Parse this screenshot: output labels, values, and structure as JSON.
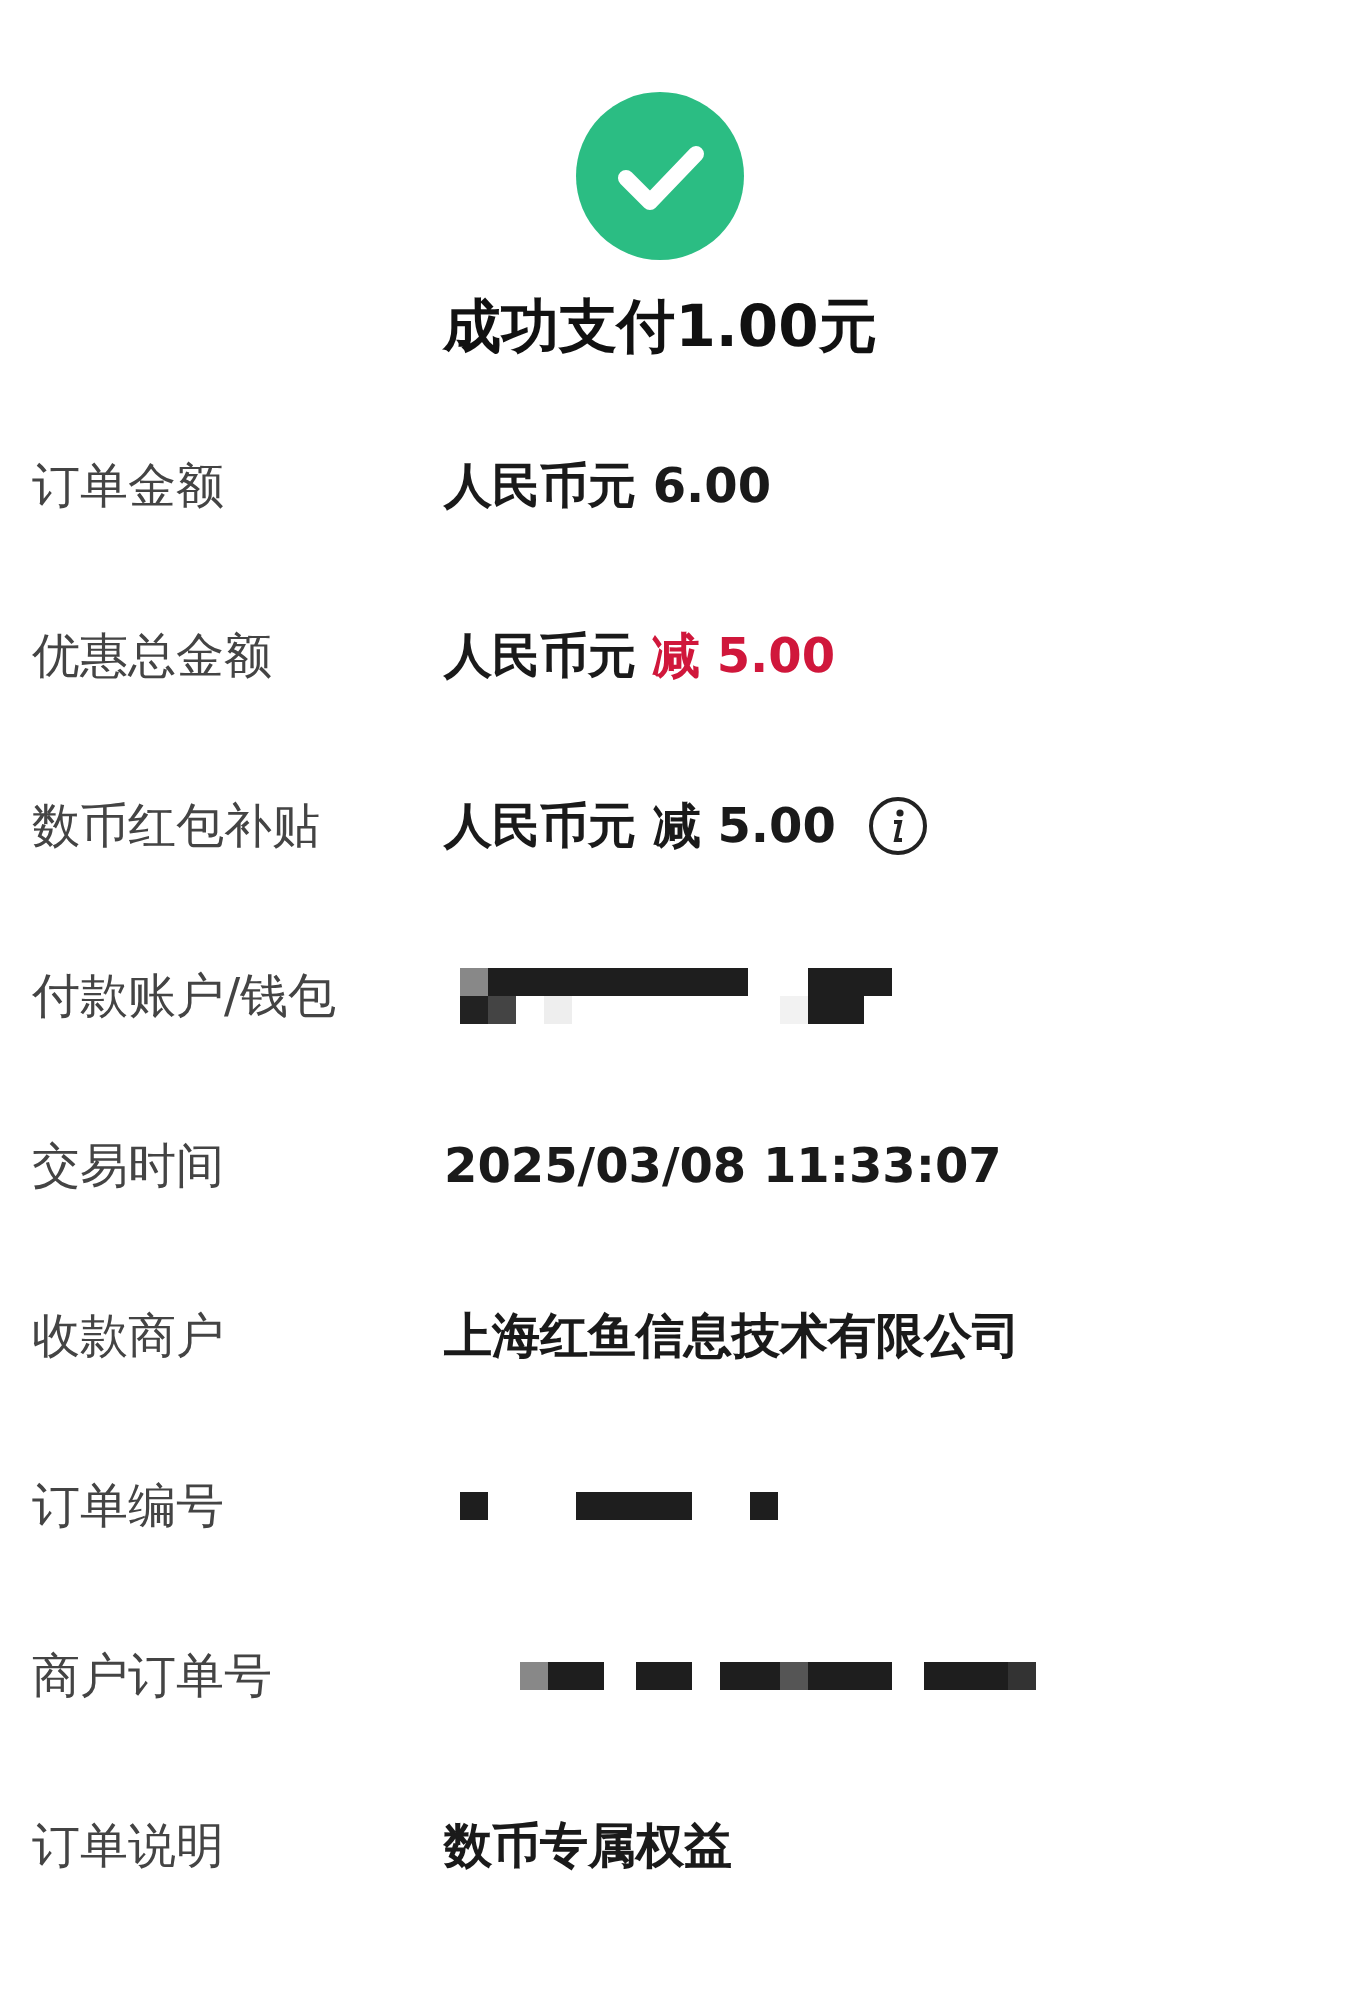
{
  "status": {
    "kind": "success",
    "title": "成功支付1.00元"
  },
  "rows": [
    {
      "label": "订单金额",
      "kind": "text",
      "value_parts": [
        {
          "text": "人民币元 6.00",
          "highlighted": false
        }
      ]
    },
    {
      "label": "优惠总金额",
      "kind": "text",
      "value_parts": [
        {
          "text": "人民币元",
          "highlighted": false
        },
        {
          "text": "减 5.00",
          "highlighted": true
        }
      ]
    },
    {
      "label": "数币红包补贴",
      "kind": "text",
      "info_button": true,
      "value_parts": [
        {
          "text": "人民币元 减 5.00",
          "highlighted": false
        }
      ]
    },
    {
      "label": "付款账户/钱包",
      "kind": "redacted"
    },
    {
      "label": "交易时间",
      "kind": "text",
      "value_parts": [
        {
          "text": "2025/03/08 11:33:07",
          "highlighted": false
        }
      ]
    },
    {
      "label": "收款商户",
      "kind": "text",
      "value_parts": [
        {
          "text": "上海红鱼信息技术有限公司",
          "highlighted": false
        }
      ]
    },
    {
      "label": "订单编号",
      "kind": "redacted"
    },
    {
      "label": "商户订单号",
      "kind": "redacted"
    },
    {
      "label": "订单说明",
      "kind": "text",
      "value_parts": [
        {
          "text": "数币专属权益",
          "highlighted": false
        }
      ]
    }
  ]
}
